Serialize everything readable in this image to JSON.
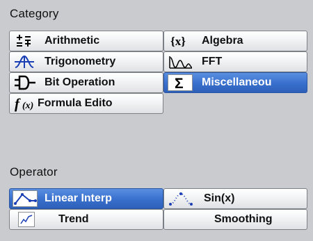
{
  "category": {
    "heading": "Category",
    "items": [
      {
        "label": "Arithmetic",
        "icon": "plus-minus-arithmetic-icon"
      },
      {
        "label": "Algebra",
        "icon": "curly-x-algebra-icon"
      },
      {
        "label": "Trigonometry",
        "icon": "sine-wave-icon"
      },
      {
        "label": "FFT",
        "icon": "fft-spectrum-icon"
      },
      {
        "label": "Bit Operation",
        "icon": "logic-gate-icon"
      },
      {
        "label": "Miscellaneou",
        "icon": "sigma-icon",
        "selected": true
      },
      {
        "label": "Formula Edito",
        "icon": "function-f-icon"
      }
    ]
  },
  "operator": {
    "heading": "Operator",
    "items": [
      {
        "label": "Linear Interp",
        "icon": "linear-interp-curve-icon",
        "selected": true
      },
      {
        "label": "Sin(x)",
        "icon": "sin-x-curve-icon"
      },
      {
        "label": "Trend",
        "icon": "trend-chart-icon"
      },
      {
        "label": "Smoothing",
        "icon": "smoothing-blank-icon"
      }
    ]
  },
  "colors": {
    "background": "#c9cbcf",
    "selected": "#3b72cf",
    "button_face": "#f2f3f5"
  }
}
